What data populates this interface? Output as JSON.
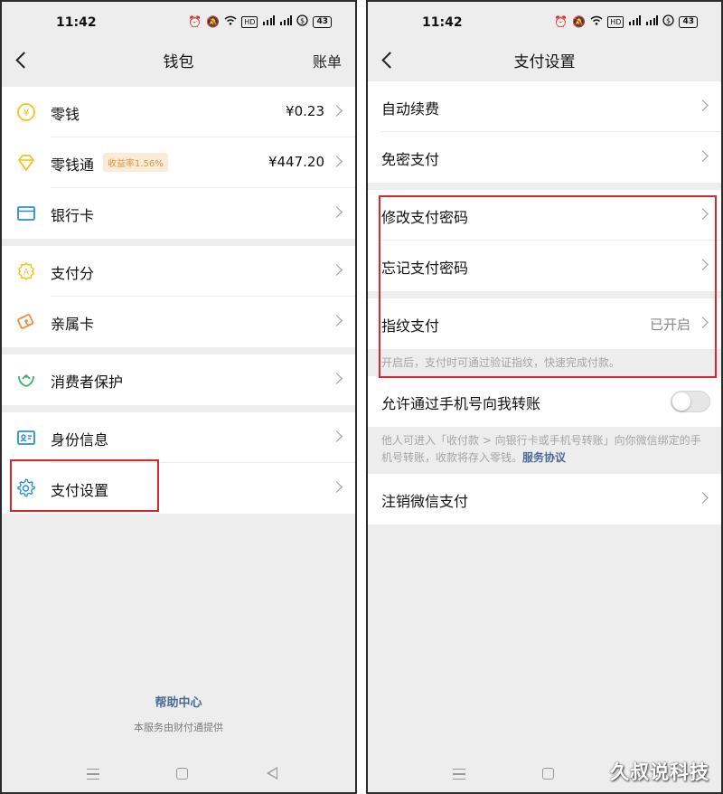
{
  "status": {
    "time": "11:42",
    "battery": "43",
    "hd_label": "HD",
    "signal_label": "5G"
  },
  "wallet": {
    "title": "钱包",
    "action": "账单",
    "items": [
      {
        "label": "零钱",
        "value": "¥0.23"
      },
      {
        "label": "零钱通",
        "badge": "收益率1.56%",
        "value": "¥447.20"
      },
      {
        "label": "银行卡"
      },
      {
        "label": "支付分"
      },
      {
        "label": "亲属卡"
      },
      {
        "label": "消费者保护"
      },
      {
        "label": "身份信息"
      },
      {
        "label": "支付设置"
      }
    ],
    "footer": {
      "help": "帮助中心",
      "provider": "本服务由财付通提供"
    },
    "colors": {
      "yellow": "#f5c21b",
      "blue": "#2b8fd6",
      "orange": "#f08a3c",
      "green": "#3bb36a",
      "highlight": "#d9252b"
    }
  },
  "settings": {
    "title": "支付设置",
    "items": [
      {
        "label": "自动续费"
      },
      {
        "label": "免密支付"
      },
      {
        "label": "修改支付密码"
      },
      {
        "label": "忘记支付密码"
      },
      {
        "label": "指纹支付",
        "value": "已开启"
      },
      {
        "label": "允许通过手机号向我转账",
        "toggle": false
      },
      {
        "label": "注销微信支付"
      }
    ],
    "fingerprint_hint": "开启后，支付时可通过验证指纹，快速完成付款。",
    "phone_hint": "他人可进入「收付款 > 向银行卡或手机号转账」向你微信绑定的手机号转账，收款将存入零钱。",
    "phone_hint_link": "服务协议"
  },
  "watermark": "久叔说科技"
}
